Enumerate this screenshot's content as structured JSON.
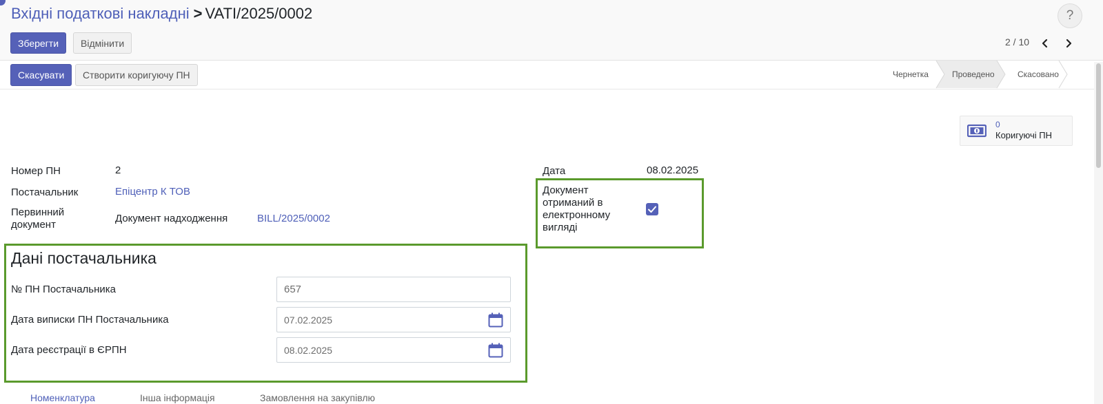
{
  "breadcrumb": {
    "parent": "Вхідні податкові накладні",
    "separator": ">",
    "current": "VATI/2025/0002"
  },
  "help_label": "?",
  "actions": {
    "save": "Зберегти",
    "discard": "Відмінити"
  },
  "pager": {
    "text": "2 / 10"
  },
  "status_actions": {
    "cancel": "Скасувати",
    "create_correction": "Створити коригуючу ПН"
  },
  "stages": [
    {
      "label": "Чернетка",
      "active": false
    },
    {
      "label": "Проведено",
      "active": true
    },
    {
      "label": "Скасовано",
      "active": false
    }
  ],
  "smart_button": {
    "count": "0",
    "label": "Коригуючі ПН",
    "icon": "money-icon"
  },
  "fields": {
    "tax_number_label": "Номер ПН",
    "tax_number_value": "2",
    "supplier_label": "Постачальник",
    "supplier_value": "Епіцентр К ТОВ",
    "primary_doc_label": "Первинний документ",
    "primary_doc_type": "Документ надходження",
    "primary_doc_value": "BILL/2025/0002",
    "date_label": "Дата",
    "date_value": "08.02.2025",
    "electronic_label": "Документ отриманий в електронному вигляді",
    "electronic_checked": true
  },
  "supplier_section": {
    "title": "Дані постачальника",
    "number_label": "№ ПН Постачальника",
    "number_value": "657",
    "issue_date_label": "Дата виписки ПН Постачальника",
    "issue_date_value": "07.02.2025",
    "reg_date_label": "Дата реєстрації в ЄРПН",
    "reg_date_value": "08.02.2025"
  },
  "tabs": [
    {
      "label": "Номенклатура",
      "active": true
    },
    {
      "label": "Інша інформація",
      "active": false
    },
    {
      "label": "Замовлення на закупівлю",
      "active": false
    }
  ],
  "colors": {
    "primary": "#5561b8",
    "link": "#4e5fb8",
    "highlight": "#5a9a2c"
  }
}
